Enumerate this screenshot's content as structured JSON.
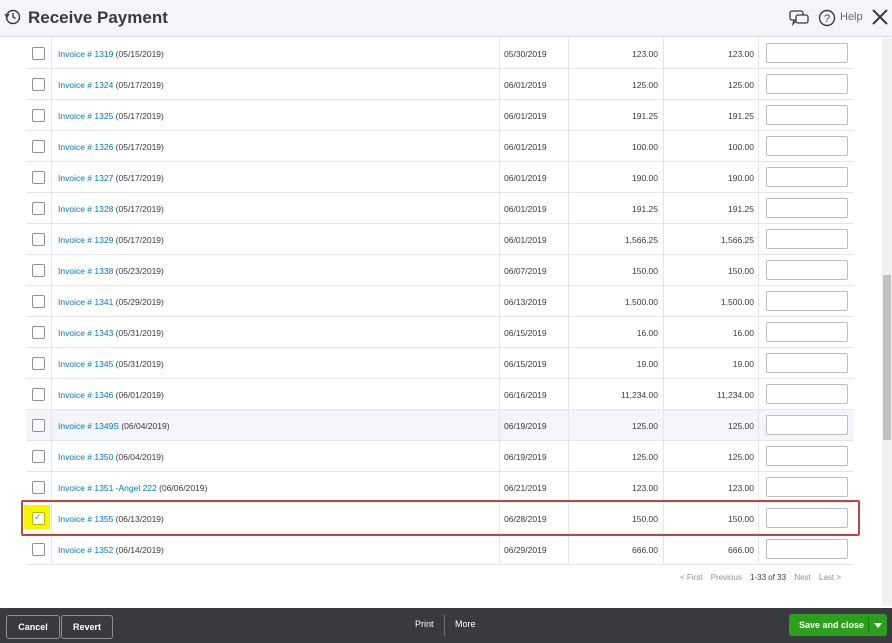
{
  "header": {
    "title": "Receive Payment",
    "help_label": "Help"
  },
  "invoices": [
    {
      "invoice": "Invoice # 1319",
      "date": " (05/15/2019)",
      "due": "05/30/2019",
      "original": "123.00",
      "open": "123.00",
      "checked": false
    },
    {
      "invoice": "Invoice # 1324",
      "date": " (05/17/2019)",
      "due": "06/01/2019",
      "original": "125.00",
      "open": "125.00",
      "checked": false
    },
    {
      "invoice": "Invoice # 1325",
      "date": " (05/17/2019)",
      "due": "06/01/2019",
      "original": "191.25",
      "open": "191.25",
      "checked": false
    },
    {
      "invoice": "Invoice # 1326",
      "date": " (05/17/2019)",
      "due": "06/01/2019",
      "original": "100.00",
      "open": "100.00",
      "checked": false
    },
    {
      "invoice": "Invoice # 1327",
      "date": " (05/17/2019)",
      "due": "06/01/2019",
      "original": "190.00",
      "open": "190.00",
      "checked": false
    },
    {
      "invoice": "Invoice # 1328",
      "date": " (05/17/2019)",
      "due": "06/01/2019",
      "original": "191.25",
      "open": "191.25",
      "checked": false
    },
    {
      "invoice": "Invoice # 1329",
      "date": " (05/17/2019)",
      "due": "06/01/2019",
      "original": "1,566.25",
      "open": "1,566.25",
      "checked": false
    },
    {
      "invoice": "Invoice # 1338",
      "date": " (05/23/2019)",
      "due": "06/07/2019",
      "original": "150.00",
      "open": "150.00",
      "checked": false
    },
    {
      "invoice": "Invoice # 1341",
      "date": " (05/29/2019)",
      "due": "06/13/2019",
      "original": "1,500.00",
      "open": "1,500.00",
      "checked": false
    },
    {
      "invoice": "Invoice # 1343",
      "date": " (05/31/2019)",
      "due": "06/15/2019",
      "original": "16.00",
      "open": "16.00",
      "checked": false
    },
    {
      "invoice": "Invoice # 1345",
      "date": " (05/31/2019)",
      "due": "06/15/2019",
      "original": "19.00",
      "open": "19.00",
      "checked": false
    },
    {
      "invoice": "Invoice # 1346",
      "date": " (06/01/2019)",
      "due": "06/16/2019",
      "original": "11,234.00",
      "open": "11,234.00",
      "checked": false
    },
    {
      "invoice": "Invoice # 1349S",
      "date": " (06/04/2019)",
      "due": "06/19/2019",
      "original": "125.00",
      "open": "125.00",
      "checked": false
    },
    {
      "invoice": "Invoice # 1350",
      "date": " (06/04/2019)",
      "due": "06/19/2019",
      "original": "125.00",
      "open": "125.00",
      "checked": false
    },
    {
      "invoice": "Invoice # 1351 -Angel 222",
      "date": " (06/06/2019)",
      "due": "06/21/2019",
      "original": "123.00",
      "open": "123.00",
      "checked": false
    },
    {
      "invoice": "Invoice # 1355",
      "date": " (06/13/2019)",
      "due": "06/28/2019",
      "original": "150.00",
      "open": "150.00",
      "checked": true
    },
    {
      "invoice": "Invoice # 1352",
      "date": " (06/14/2019)",
      "due": "06/29/2019",
      "original": "666.00",
      "open": "666.00",
      "checked": false
    }
  ],
  "pager": {
    "first": "< First",
    "previous": "Previous",
    "range": "1-33 of 33",
    "next": "Next",
    "last": "Last >"
  },
  "footer": {
    "cancel": "Cancel",
    "revert": "Revert",
    "print": "Print",
    "more": "More",
    "save_close": "Save and close"
  },
  "colors": {
    "link": "#0077c5",
    "save_button": "#2ca01c",
    "selection_outline": "#b24a4a",
    "checkbox_highlight": "#f5f500"
  }
}
